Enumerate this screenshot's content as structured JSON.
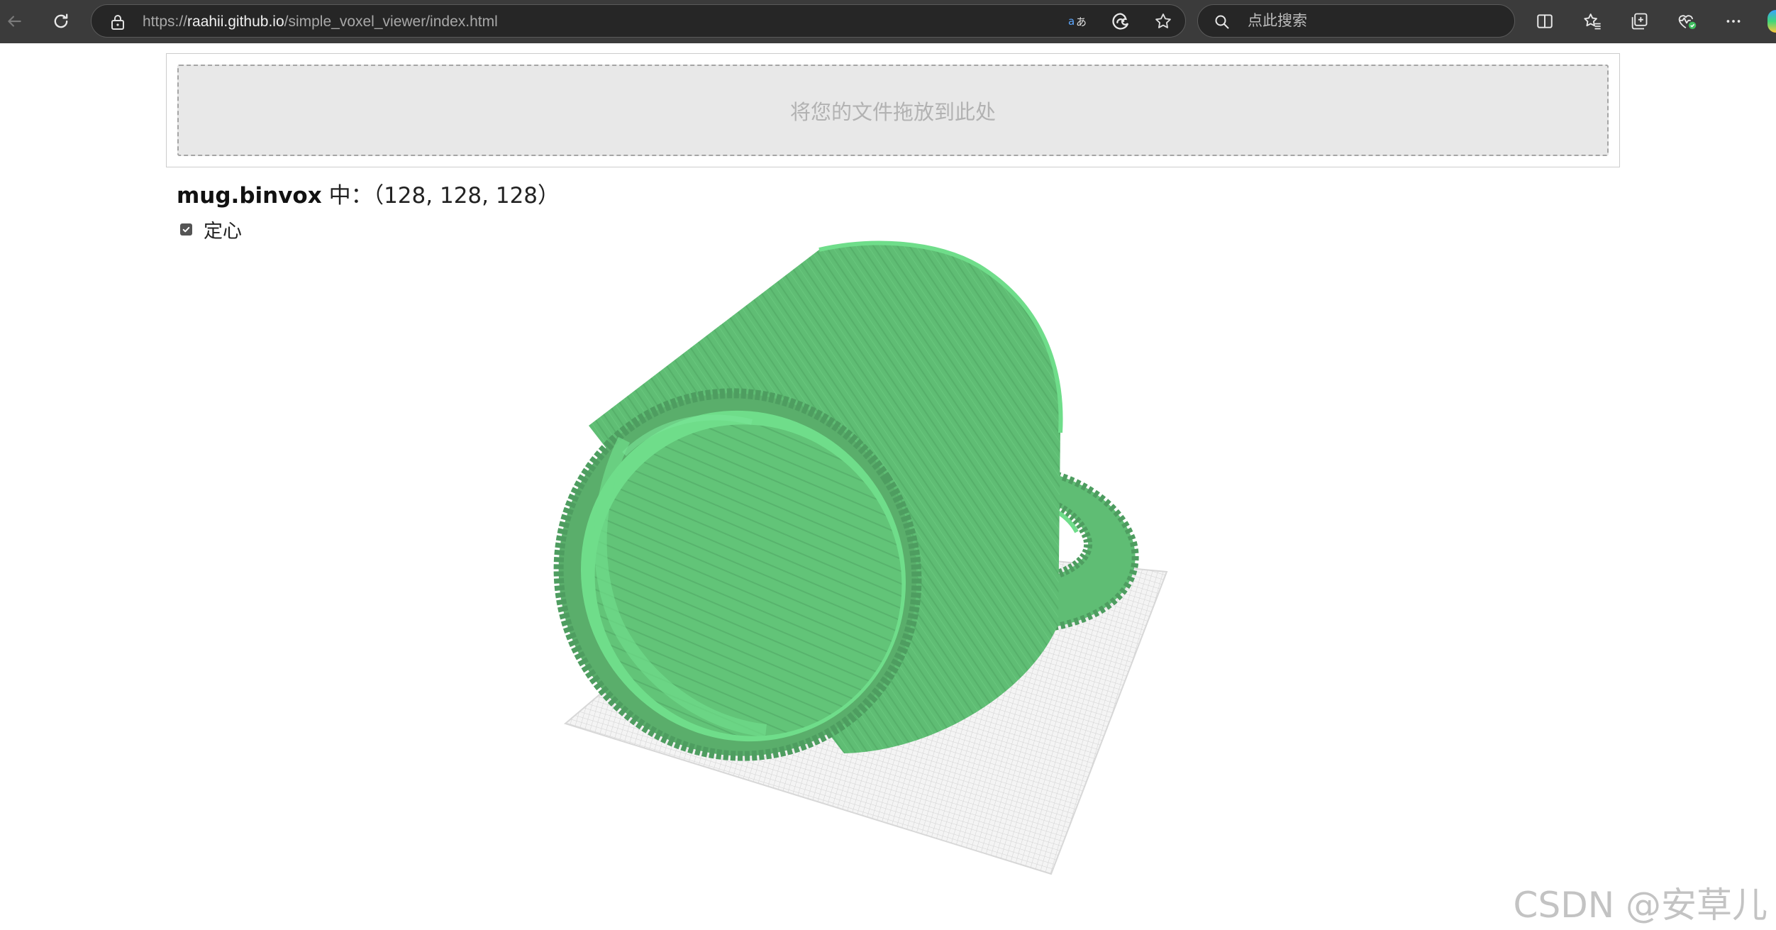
{
  "browser": {
    "url_scheme": "https://",
    "url_host": "raahii.github.io",
    "url_path": "/simple_voxel_viewer/index.html",
    "search_placeholder": "点此搜索",
    "icons": {
      "back": "back-arrow-icon",
      "reload": "reload-icon",
      "lock": "lock-icon",
      "read_aloud": "read-aloud-icon",
      "edge": "edge-icon",
      "favorite": "star-icon",
      "search": "search-icon",
      "split_screen": "split-screen-icon",
      "favorites": "favorites-icon",
      "collections": "collections-icon",
      "browser_essentials": "heart-pulse-icon",
      "more": "more-icon"
    },
    "colors": {
      "toolbar": "#3b3b3b",
      "field": "#262626"
    }
  },
  "page": {
    "drop_zone_label": "将您的文件拖放到此处",
    "file_name": "mug.binvox",
    "file_info_suffix": " 中：（128, 128, 128）",
    "center_label": "定心",
    "center_checked": true
  },
  "viewer": {
    "model": "mug",
    "voxel_grid": [
      128,
      128,
      128
    ],
    "colors": {
      "voxel_light": "#6fdd8a",
      "voxel_mid": "#5fbd74",
      "voxel_dark": "#4e9d60",
      "floor_grid": "#d9d9d9"
    }
  },
  "watermark": "CSDN @安草儿"
}
